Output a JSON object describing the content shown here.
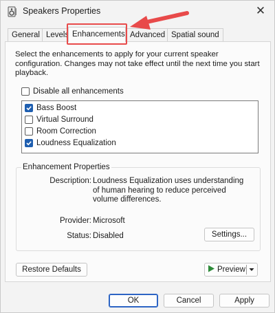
{
  "window": {
    "title": "Speakers Properties",
    "close_glyph": "✕"
  },
  "tabs": [
    {
      "label": "General"
    },
    {
      "label": "Levels"
    },
    {
      "label": "Enhancements",
      "active": true
    },
    {
      "label": "Advanced"
    },
    {
      "label": "Spatial sound"
    }
  ],
  "intro_text": "Select the enhancements to apply for your current speaker configuration. Changes may not take effect until the next time you start playback.",
  "disable_all": {
    "label": "Disable all enhancements",
    "checked": false
  },
  "enhancements": [
    {
      "label": "Bass Boost",
      "checked": true
    },
    {
      "label": "Virtual Surround",
      "checked": false
    },
    {
      "label": "Room Correction",
      "checked": false
    },
    {
      "label": "Loudness Equalization",
      "checked": true
    }
  ],
  "properties": {
    "title": "Enhancement Properties",
    "description_label": "Description:",
    "description_value": "Loudness Equalization uses understanding of human hearing to reduce perceived volume differences.",
    "provider_label": "Provider:",
    "provider_value": "Microsoft",
    "status_label": "Status:",
    "status_value": "Disabled",
    "settings_button": "Settings..."
  },
  "buttons": {
    "restore_defaults": "Restore Defaults",
    "preview": "Preview",
    "ok": "OK",
    "cancel": "Cancel",
    "apply": "Apply"
  },
  "colors": {
    "accent": "#1f5fb0",
    "annotation": "#e84a4a",
    "play_green": "#2e8b3a"
  },
  "icons": {
    "title": "speaker-icon",
    "close": "close-icon",
    "play": "play-icon",
    "dropdown": "chevron-down-icon",
    "annotation": "red-arrow-icon"
  }
}
